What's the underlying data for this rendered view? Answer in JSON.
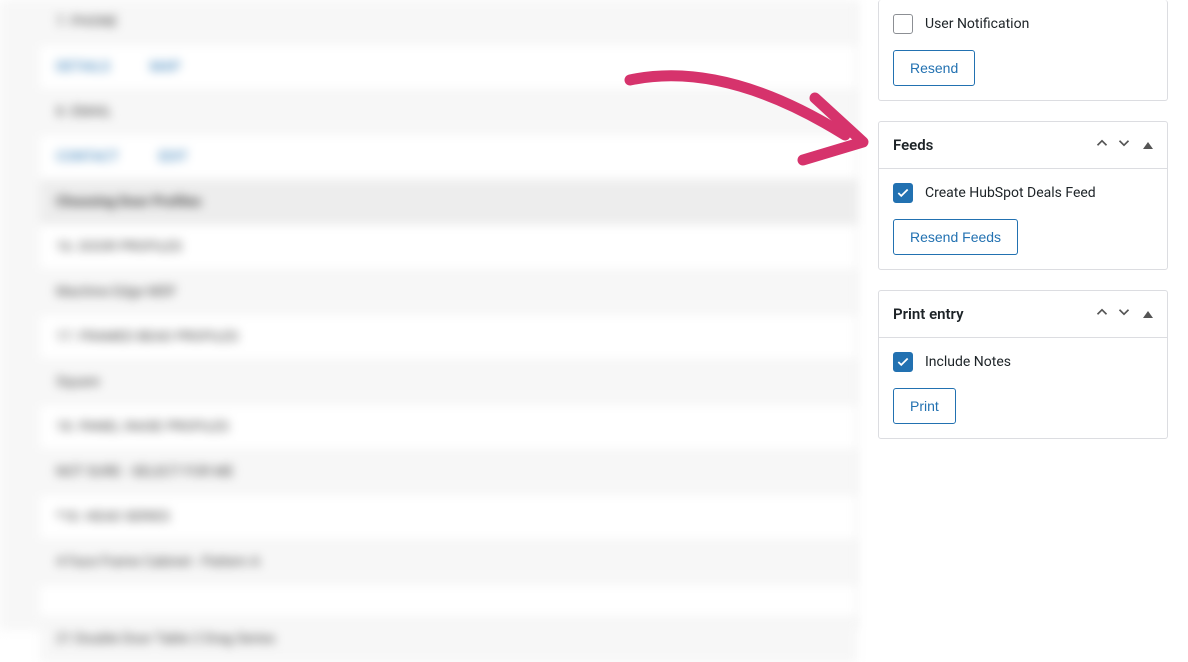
{
  "main": {
    "row1_label": "7. PHONE",
    "row2_link1": "DETAILS",
    "row2_link2": "MAP",
    "row3_label": "8. EMAIL",
    "row4_link1": "CONTACT",
    "row4_link2": "EDIT",
    "section_header": "Choosing Door Profiles",
    "row5": "16. DOOR PROFILES",
    "row6": "Machine Edge MDF",
    "row7": "17. FRAMED BEAD PROFILES",
    "row8": "Square",
    "row9": "18. PANEL RAISE PROFILES",
    "row10": "NOT SURE - SELECT FOR ME",
    "row11": "*18. HEAD SERIES",
    "row12": "4 Face Frame Cabinet - Pattern A",
    "row13": "21 Double Door Table 2 Drag Series"
  },
  "sidebar": {
    "notifications": {
      "user_notification_label": "User Notification",
      "resend_button": "Resend"
    },
    "feeds": {
      "title": "Feeds",
      "create_feed_label": "Create HubSpot Deals Feed",
      "resend_button": "Resend Feeds"
    },
    "print_entry": {
      "title": "Print entry",
      "include_notes_label": "Include Notes",
      "print_button": "Print"
    }
  }
}
